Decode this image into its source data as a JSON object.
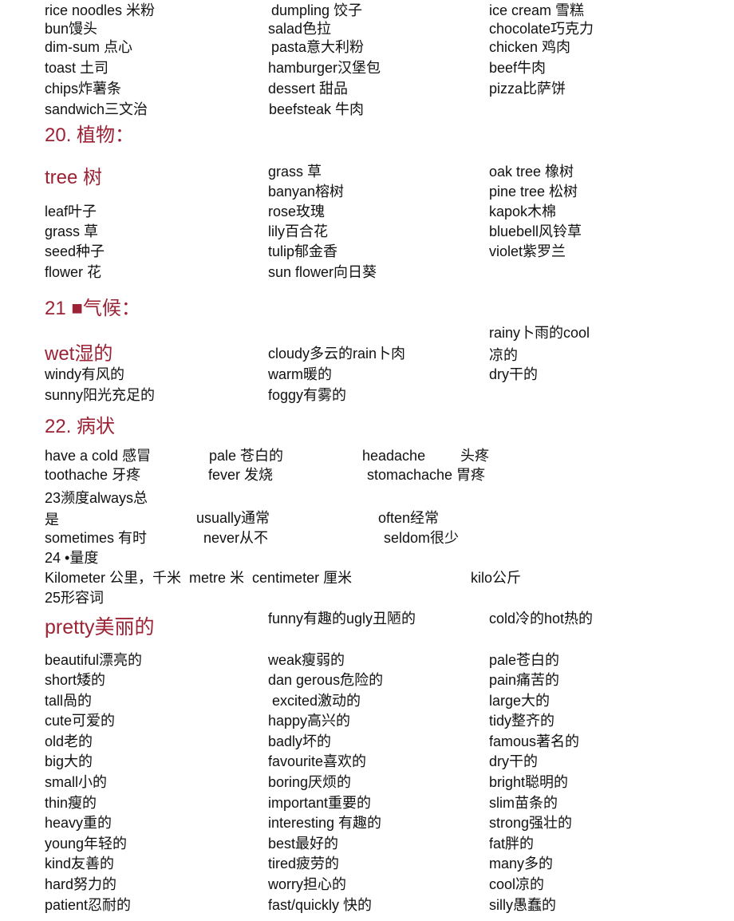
{
  "colors": {
    "heading": "#9b2335",
    "text": "#111111"
  },
  "food": {
    "col1": [
      "rice noodles 米粉",
      "bun馒头",
      "dim-sum 点心",
      "toast 土司",
      "chips炸薯条",
      "sandwich三文治"
    ],
    "col2": [
      "dumpling 饺子",
      "salad色拉",
      "pasta意大利粉",
      "hamburger汉堡包",
      "dessert 甜品",
      "beefsteak 牛肉"
    ],
    "col3": [
      "ice cream 雪糕",
      "chocolate巧克力",
      "chicken 鸡肉",
      "beef牛肉",
      "pizza比萨饼"
    ]
  },
  "plants": {
    "heading": "20. 植物：",
    "lead": "tree 树",
    "col1": [
      "leaf叶子",
      "grass 草",
      "seed种子",
      "flower 花"
    ],
    "col2": [
      "grass 草",
      "banyan榕树",
      "rose玫瑰",
      "lily百合花",
      "tulip郁金香",
      "sun flower向日葵"
    ],
    "col3": [
      "oak tree 橡树",
      "pine tree 松树",
      "kapok木棉",
      "bluebell风铃草",
      "violet紫罗兰"
    ]
  },
  "climate": {
    "heading": "21 ■气候：",
    "lead": "wet湿的",
    "col1": [
      "windy有风的",
      "sunny阳光充足的"
    ],
    "col2": [
      "cloudy多云的rain卜肉",
      "warm暖的",
      "foggy有雾的"
    ],
    "col3": [
      "rainy卜雨的cool",
      "凉的",
      "dry干的"
    ]
  },
  "symptoms": {
    "heading": "22. 病状",
    "rows": [
      [
        "have a cold 感冒",
        "pale 苍白的",
        "headache",
        "头疼"
      ],
      [
        "toothache 牙疼",
        "fever 发烧",
        "stomachache 胃疼",
        ""
      ]
    ]
  },
  "frequency": {
    "line1": "23濒度always总",
    "row2": [
      "是",
      "usually通常",
      "often经常"
    ],
    "row3": [
      "sometimes 有时",
      "never从不",
      "seldom很少"
    ]
  },
  "measure": {
    "heading": "24 •量度",
    "items": [
      "Kilometer 公里，千米  metre 米  centimeter 厘米",
      "kilo公斤"
    ]
  },
  "adjectives": {
    "heading": "25形容词",
    "lead": "pretty美丽的",
    "top2": "funny有趣的ugly丑陋的",
    "top3": "cold冷的hot热的",
    "col1": [
      "beautiful漂亮的",
      "short矮的",
      "tall咼的",
      "cute可爱的",
      "old老的",
      "big大的",
      "small小的",
      "thin瘦的",
      "heavy重的",
      "young年轻的",
      "kind友善的",
      "hard努力的",
      "patient忍耐的"
    ],
    "col2": [
      "weak瘦弱的",
      "dan gerous危险的",
      " excited激动的",
      "happy高兴的",
      "badly坏的",
      "favourite喜欢的",
      "boring厌烦的",
      "important重要的",
      "interesting 有趣的",
      "best最好的",
      "tired疲劳的",
      "worry担心的",
      "fast/quickly 快的"
    ],
    "col3": [
      "pale苍白的",
      "pain痛苦的",
      "large大的",
      "tidy整齐的",
      "famous著名的",
      "dry干的",
      "bright聪明的",
      "slim苗条的",
      "strong强壮的",
      "fat胖的",
      "many多的",
      "cool凉的",
      "silly愚蠢的"
    ]
  }
}
